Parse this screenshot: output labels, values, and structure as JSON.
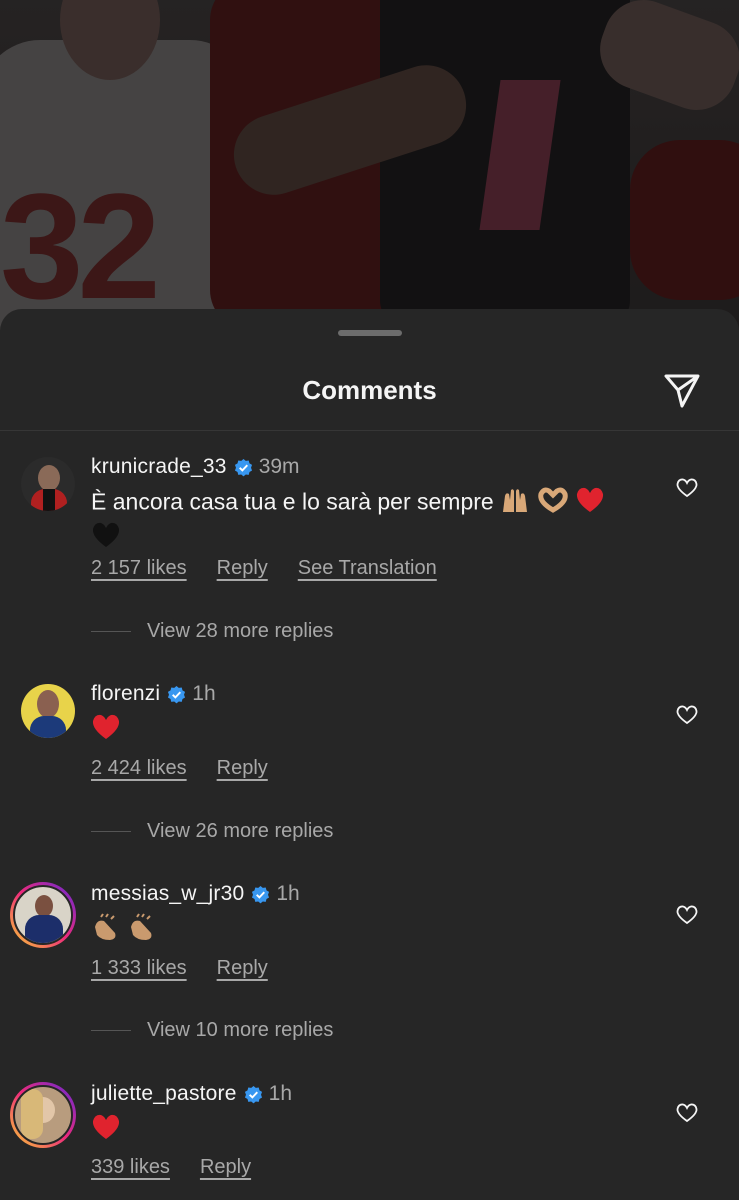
{
  "sheet": {
    "title": "Comments",
    "share_icon": "send-icon"
  },
  "comments": [
    {
      "username": "krunicrade_33",
      "verified": true,
      "time": "39m",
      "text": "È ancora casa tua e lo sarà per sempre",
      "emojis": [
        "raising-hands",
        "heart-hands",
        "red-heart",
        "black-heart"
      ],
      "likes": "2 157 likes",
      "reply": "Reply",
      "translate": "See Translation",
      "more_replies": "View 28 more replies"
    },
    {
      "username": "florenzi",
      "verified": true,
      "time": "1h",
      "text": "",
      "emojis": [
        "red-heart"
      ],
      "likes": "2 424 likes",
      "reply": "Reply",
      "more_replies": "View 26 more replies"
    },
    {
      "username": "messias_w_jr30",
      "verified": true,
      "time": "1h",
      "text": "",
      "emojis": [
        "clapping-hands",
        "clapping-hands"
      ],
      "likes": "1 333 likes",
      "reply": "Reply",
      "more_replies": "View 10 more replies"
    },
    {
      "username": "juliette_pastore",
      "verified": true,
      "time": "1h",
      "text": "",
      "emojis": [
        "red-heart"
      ],
      "likes": "339 likes",
      "reply": "Reply"
    }
  ],
  "colors": {
    "background": "#262626",
    "text": "#f5f5f5",
    "secondary": "#a8a8a8",
    "verified": "#3897f0",
    "heart": "#e0245e"
  }
}
